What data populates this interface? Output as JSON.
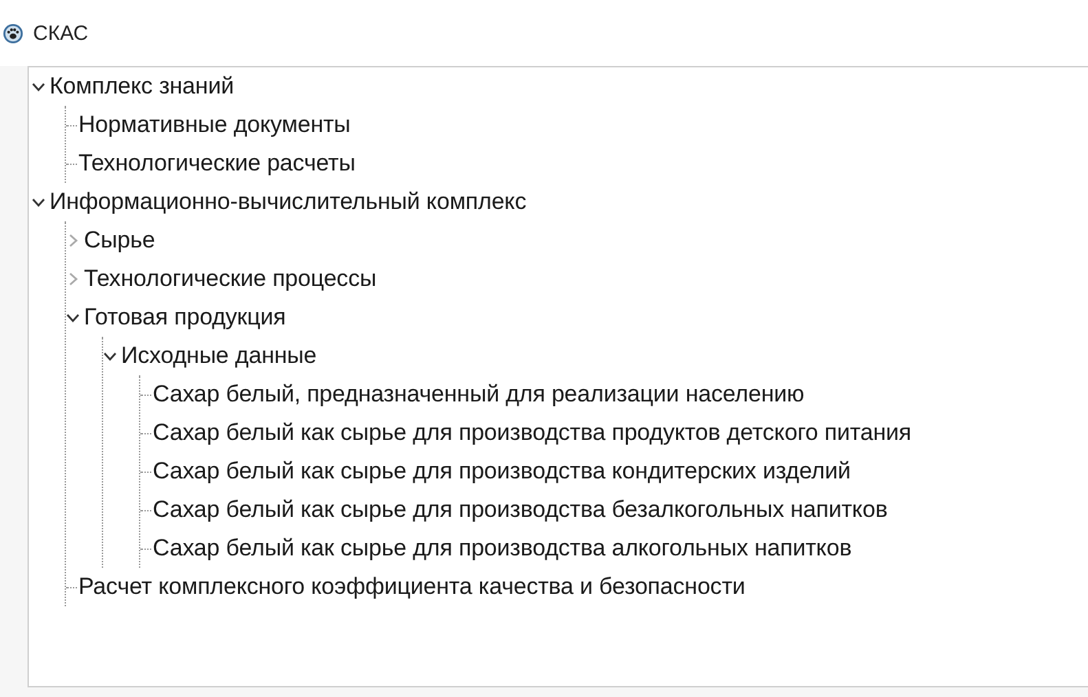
{
  "window": {
    "title": "СКАС"
  },
  "tree": [
    {
      "label": "Комплекс знаний",
      "expanded": true,
      "children": [
        {
          "label": "Нормативные документы"
        },
        {
          "label": "Технологические расчеты"
        }
      ]
    },
    {
      "label": "Информационно-вычислительный комплекс",
      "expanded": true,
      "children": [
        {
          "label": "Сырье",
          "expanded": false
        },
        {
          "label": "Технологические процессы",
          "expanded": false
        },
        {
          "label": "Готовая продукция",
          "expanded": true,
          "children": [
            {
              "label": "Исходные данные",
              "expanded": true,
              "children": [
                {
                  "label": "Сахар белый, предназначенный для реализации населению"
                },
                {
                  "label": "Сахар белый как сырье для производства продуктов детского питания"
                },
                {
                  "label": "Сахар белый как сырье для производства кондитерских изделий"
                },
                {
                  "label": "Сахар белый как сырье для производства безалкогольных напитков"
                },
                {
                  "label": "Сахар белый как сырье для производства алкогольных напитков"
                }
              ]
            }
          ]
        },
        {
          "label": "Расчет комплексного коэффициента качества и безопасности"
        }
      ]
    }
  ]
}
